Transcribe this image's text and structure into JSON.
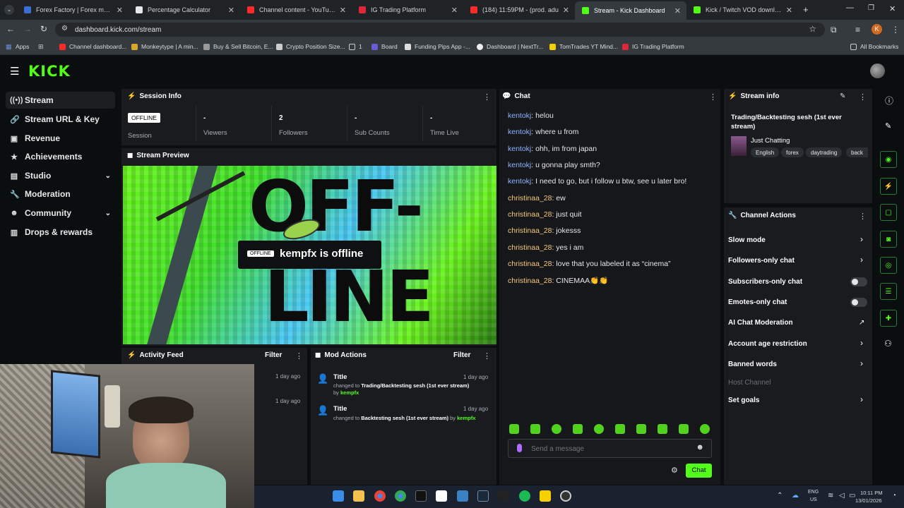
{
  "browser": {
    "tabs": [
      {
        "label": "Forex Factory | Forex markets fo",
        "color": "#3b6fd6"
      },
      {
        "label": "Percentage Calculator",
        "color": "#e8e8e8"
      },
      {
        "label": "Channel content - YouTube Stu",
        "color": "#ff2a2a"
      },
      {
        "label": "IG Trading Platform",
        "color": "#e0273a"
      },
      {
        "label": "(184) 11:59PM - (prod. adu",
        "color": "#ff2a2a"
      },
      {
        "label": "Stream - Kick Dashboard",
        "color": "#53fc18"
      },
      {
        "label": "Kick / Twitch VOD downloader",
        "color": "#53fc18"
      }
    ],
    "url": "dashboard.kick.com/stream",
    "bookmarks": [
      {
        "label": "Apps",
        "color": "#6d8fd8"
      },
      {
        "label": "Channel dashboard...",
        "color": "#ff2a2a"
      },
      {
        "label": "Monkeytype | A min...",
        "color": "#d9a62c"
      },
      {
        "label": "Buy & Sell Bitcoin, E...",
        "color": "#999"
      },
      {
        "label": "Crypto Position Size...",
        "color": "#ccc"
      },
      {
        "label": "1",
        "color": "#d9a62c"
      },
      {
        "label": "Board",
        "color": "#6b5bd6"
      },
      {
        "label": "Funding Pips App -...",
        "color": "#ddd"
      },
      {
        "label": "Dashboard | NextTr...",
        "color": "#eee"
      },
      {
        "label": "TomTrades YT Mind...",
        "color": "#f0d000"
      },
      {
        "label": "IG Trading Platform",
        "color": "#e0273a"
      },
      {
        "label": "All Bookmarks",
        "color": "#d9a62c"
      }
    ]
  },
  "kick": {
    "logo": "KICK"
  },
  "sidebar": {
    "items": [
      {
        "label": "Stream",
        "icon": "radio-icon"
      },
      {
        "label": "Stream URL & Key",
        "icon": "link-icon"
      },
      {
        "label": "Revenue",
        "icon": "dollar-icon"
      },
      {
        "label": "Achievements",
        "icon": "trophy-icon"
      },
      {
        "label": "Studio",
        "icon": "studio-icon"
      },
      {
        "label": "Moderation",
        "icon": "wrench-icon"
      },
      {
        "label": "Community",
        "icon": "community-icon"
      },
      {
        "label": "Drops & rewards",
        "icon": "gift-icon"
      }
    ]
  },
  "session": {
    "title": "Session Info",
    "badge": "OFFLINE",
    "session_label": "Session",
    "stats": [
      {
        "value": "-",
        "label": "Viewers"
      },
      {
        "value": "2",
        "label": "Followers"
      },
      {
        "value": "-",
        "label": "Sub Counts"
      },
      {
        "value": "-",
        "label": "Time Live"
      }
    ]
  },
  "preview": {
    "title": "Stream Preview",
    "badge": "OFFLINE",
    "message": "kempfx is offline",
    "art_text_1": "OFF-",
    "art_text_2": "LINE"
  },
  "activity": {
    "title": "Activity Feed",
    "filter": "Filter",
    "times": [
      "1 day ago",
      "1 day ago"
    ]
  },
  "mod_actions": {
    "title": "Mod Actions",
    "filter": "Filter",
    "items": [
      {
        "title": "Title",
        "time": "1 day ago",
        "prefix": "changed to",
        "value": "Trading/Backtesting sesh (1st ever stream)",
        "by": "by",
        "user": "kempfx"
      },
      {
        "title": "Title",
        "time": "1 day ago",
        "prefix": "changed to",
        "value": "Backtesting sesh (1st ever stream)",
        "by": "by",
        "user": "kempfx"
      }
    ]
  },
  "chat": {
    "title": "Chat",
    "messages": [
      {
        "user": "kentokj",
        "text": ": helou"
      },
      {
        "user": "kentokj",
        "text": ": where u from"
      },
      {
        "user": "kentokj",
        "text": ": ohh, im from japan"
      },
      {
        "user": "kentokj",
        "text": ": u gonna play smth?"
      },
      {
        "user": "kentokj",
        "text": ": I need to go, but i follow u btw, see u later bro!"
      },
      {
        "user": "christinaa_28",
        "text": ": ew"
      },
      {
        "user": "christinaa_28",
        "text": ": just quit"
      },
      {
        "user": "christinaa_28",
        "text": ": jokesss"
      },
      {
        "user": "christinaa_28",
        "text": ": yes i am"
      },
      {
        "user": "christinaa_28",
        "text": ": love that you labeled it as “cinema”"
      },
      {
        "user": "christinaa_28",
        "text": ": CINEMAA👏👏"
      }
    ],
    "placeholder": "Send a message",
    "send_label": "Chat"
  },
  "stream_info": {
    "title": "Stream info",
    "stream_title": "Trading/Backtesting sesh (1st ever stream)",
    "category": "Just Chatting",
    "tags": [
      "English",
      "forex",
      "daytrading",
      "back"
    ]
  },
  "channel_actions": {
    "title": "Channel Actions",
    "items": [
      {
        "label": "Slow mode",
        "control": "chevron"
      },
      {
        "label": "Followers-only chat",
        "control": "chevron"
      },
      {
        "label": "Subscribers-only chat",
        "control": "toggle"
      },
      {
        "label": "Emotes-only chat",
        "control": "toggle"
      },
      {
        "label": "AI Chat Moderation",
        "control": "external"
      },
      {
        "label": "Account age restriction",
        "control": "chevron"
      },
      {
        "label": "Banned words",
        "control": "chevron"
      },
      {
        "label": "Host Channel",
        "control": "none"
      },
      {
        "label": "Set goals",
        "control": "chevron"
      }
    ]
  },
  "taskbar": {
    "lang": "ENG",
    "region": "US",
    "time": "10:11 PM",
    "date": "13/01/2026"
  },
  "colors": {
    "kick_green": "#53fc18",
    "panel_bg": "#191b1f",
    "page_bg": "#0b0e0f"
  }
}
